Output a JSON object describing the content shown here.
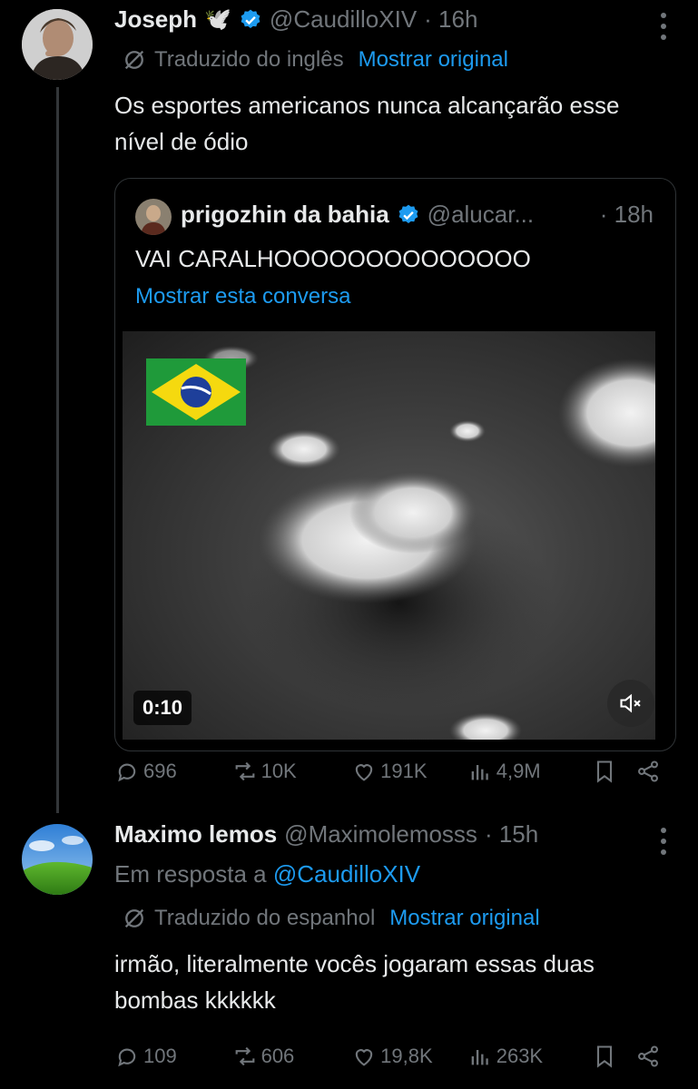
{
  "tweet1": {
    "name": "Joseph",
    "emoji": "🕊️",
    "handle": "@CaudilloXIV",
    "time": "· 16h",
    "translated_label": "Traduzido do inglês",
    "show_original": "Mostrar original",
    "text": "Os esportes americanos nunca alcançarão esse nível de ódio",
    "quote": {
      "name": "prigozhin da bahia",
      "handle": "@alucar...",
      "time": "· 18h",
      "text": "VAI CARALHOOOOOOOOOOOOOO",
      "show_thread": "Mostrar esta conversa",
      "video_duration": "0:10"
    },
    "stats": {
      "replies": "696",
      "reposts": "10K",
      "likes": "191K",
      "views": "4,9M"
    }
  },
  "tweet2": {
    "name": "Maximo lemos",
    "handle": "@Maximolemosss",
    "time": "· 15h",
    "reply_prefix": "Em resposta a",
    "reply_to": "@CaudilloXIV",
    "translated_label": "Traduzido do espanhol",
    "show_original": "Mostrar original",
    "text": "irmão, literalmente vocês jogaram essas duas bombas kkkkkk",
    "stats": {
      "replies": "109",
      "reposts": "606",
      "likes": "19,8K",
      "views": "263K"
    }
  },
  "colors": {
    "accent": "#1d9bf0",
    "muted": "#71767b",
    "text": "#e7e9ea",
    "border": "#2f3336"
  },
  "icons": [
    "verified-badge-icon",
    "translate-icon",
    "more-icon",
    "reply-icon",
    "repost-icon",
    "like-icon",
    "views-icon",
    "bookmark-icon",
    "share-icon",
    "mute-icon"
  ]
}
